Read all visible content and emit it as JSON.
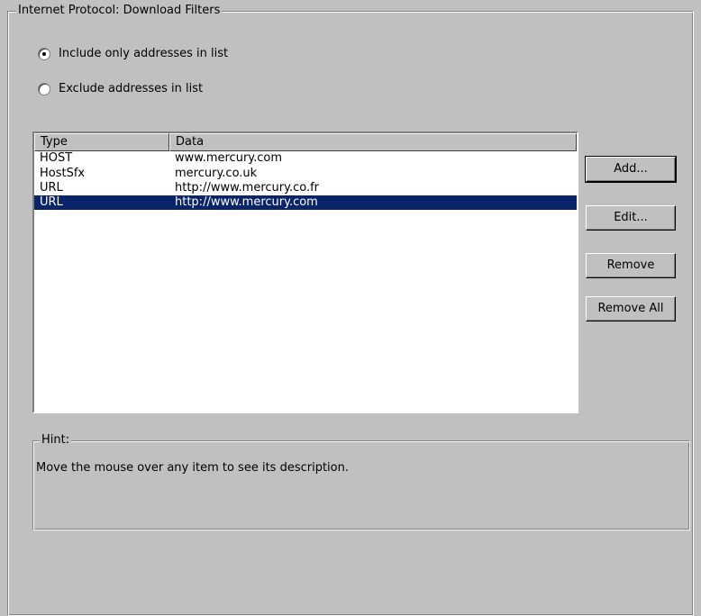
{
  "panel": {
    "title": "Internet Protocol: Download Filters"
  },
  "mode": {
    "options": [
      {
        "label": "Include only addresses in list",
        "selected": true
      },
      {
        "label": "Exclude addresses in list",
        "selected": false
      }
    ]
  },
  "table": {
    "columns": [
      "Type",
      "Data"
    ],
    "rows": [
      {
        "type": "HOST",
        "data": "www.mercury.com",
        "selected": false
      },
      {
        "type": "HostSfx",
        "data": "mercury.co.uk",
        "selected": false
      },
      {
        "type": "URL",
        "data": "http://www.mercury.co.fr",
        "selected": false
      },
      {
        "type": "URL",
        "data": "http://www.mercury.com",
        "selected": true
      }
    ]
  },
  "buttons": {
    "add": "Add...",
    "edit": "Edit...",
    "remove": "Remove",
    "remove_all": "Remove All"
  },
  "hint": {
    "title": "Hint:",
    "text": "Move the mouse over any item to see its description."
  },
  "colors": {
    "background": "#c0c0c0",
    "selection": "#0a246a",
    "list_background": "#ffffff"
  }
}
